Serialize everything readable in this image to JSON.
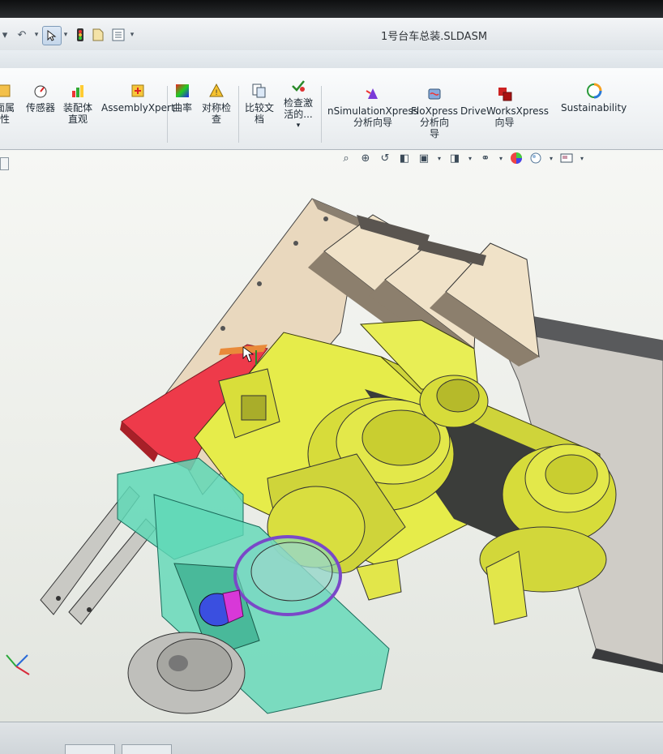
{
  "window": {
    "title": "1号台车总装.SLDASM"
  },
  "quick_access": [
    {
      "name": "arrow-dropdown-icon"
    },
    {
      "name": "undo-icon"
    },
    {
      "name": "select-pointer-icon"
    },
    {
      "name": "traffic-light-icon"
    },
    {
      "name": "file-properties-icon"
    },
    {
      "name": "options-icon"
    }
  ],
  "ribbon": {
    "buttons": [
      {
        "id": "section",
        "label1": "面属",
        "label2": "性"
      },
      {
        "id": "sensor",
        "label1": "传感器",
        "label2": ""
      },
      {
        "id": "assembly-vis",
        "label1": "装配体",
        "label2": "直观"
      },
      {
        "id": "assemblyxpert",
        "label1": "AssemblyXpert",
        "label2": ""
      },
      {
        "id": "curvature",
        "label1": "曲率",
        "label2": ""
      },
      {
        "id": "symmetry",
        "label1": "对称检",
        "label2": "查"
      },
      {
        "id": "compare",
        "label1": "比较文",
        "label2": "档"
      },
      {
        "id": "check-active",
        "label1": "检查激",
        "label2": "活的..."
      },
      {
        "id": "simxpress",
        "label1": "nSimulationXpress",
        "label2": "分析向导"
      },
      {
        "id": "floxpress",
        "label1": "FloXpress",
        "label2": "分析向",
        "label3": "导"
      },
      {
        "id": "driveworks",
        "label1": "DriveWorksXpress",
        "label2": "向导"
      },
      {
        "id": "sustain",
        "label1": "Sustainability",
        "label2": ""
      }
    ]
  },
  "view_toolbar": [
    {
      "name": "zoom-to-fit-icon"
    },
    {
      "name": "zoom-area-icon"
    },
    {
      "name": "previous-view-icon"
    },
    {
      "name": "section-view-icon"
    },
    {
      "name": "view-orientation-icon"
    },
    {
      "name": "display-style-icon"
    },
    {
      "name": "hide-show-items-icon"
    },
    {
      "name": "edit-appearance-icon"
    },
    {
      "name": "apply-scene-icon"
    },
    {
      "name": "view-settings-icon"
    }
  ],
  "colors": {
    "frame_tan": "#e8d7bd",
    "steel_gray": "#b9b5ad",
    "yellow_part": "#e6ec4a",
    "red_part": "#ee3a4a",
    "transparent_teal": "#5fd8b6",
    "blue_part": "#3a4fe0",
    "magenta_part": "#d838d8"
  }
}
